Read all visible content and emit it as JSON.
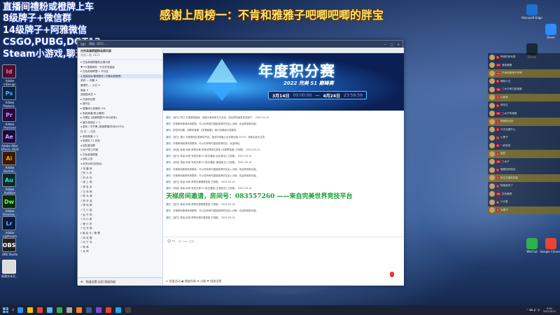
{
  "overlay": {
    "lines": [
      "直播间禮粉或橙牌上车",
      "8级牌子+微信群",
      "14级牌子+阿雅微信",
      "CSGO,PUBG,DOTA2",
      "Steam小游戏,聊天"
    ],
    "thanks": "感谢上周榜一：不肯和雅雅子吧唧吧唧的胖宝"
  },
  "desktop_left": [
    {
      "abbr": "Id",
      "label": "Adobe InDesign",
      "color": "#4a0f2e",
      "fg": "#ff6fa0"
    },
    {
      "abbr": "Ps",
      "label": "Adobe Photosh...",
      "color": "#0b2340",
      "fg": "#4ab3ff"
    },
    {
      "abbr": "Pr",
      "label": "Adobe Premiere",
      "color": "#250a3a",
      "fg": "#c58bff"
    },
    {
      "abbr": "Ae",
      "label": "Adobe After Effects 2020",
      "color": "#1a0a3a",
      "fg": "#c8a0ff"
    },
    {
      "abbr": "Ai",
      "label": "Adobe Illustrat...",
      "color": "#3a1a00",
      "fg": "#ff9a2a"
    },
    {
      "abbr": "Au",
      "label": "Adobe Audition",
      "color": "#0a2a2a",
      "fg": "#3de0c0"
    },
    {
      "abbr": "Dw",
      "label": "Adobe Dreamw...",
      "color": "#0a2a0a",
      "fg": "#6aff6a"
    },
    {
      "abbr": "Lr",
      "label": "Adobe Lightroom",
      "color": "#0a1a3a",
      "fg": "#6ab0ff"
    },
    {
      "abbr": "OBS",
      "label": "OBS Studio",
      "color": "#222",
      "fg": "#fff"
    },
    {
      "abbr": "",
      "label": "新建文本文...",
      "color": "#ddd",
      "fg": "#333"
    }
  ],
  "desktop_right": [
    {
      "label": "Microsoft Edge",
      "color": "#1f6fd1"
    },
    {
      "label": "Zoom",
      "color": "#2d8cff"
    },
    {
      "label": "Steam",
      "color": "#1b2838"
    },
    {
      "label": "WeChat",
      "color": "#2bb24c"
    },
    {
      "label": "Google Chrome",
      "color": "#e94335"
    }
  ],
  "window": {
    "title_left": "SBC",
    "title_center": "频道: 1853 …",
    "left_header": "白色英雄联盟粉丝俱乐部",
    "left_header_sub": "频道人数 1853",
    "tree": [
      "▾ 白色英雄联盟粉丝俱乐部",
      "  ♥ PG语音服务 · 不允许发链接",
      "  ▾ 白色英雄联盟 1 不分区",
      "    ◂ 语音接待/管理服务 (不要私聊管理)",
      "      老铁 — 阿雅 ✦",
      "      管理员 — 小白 ✦",
      "      兔兔 ✦",
      "      语音接待员 ✦",
      "    ▸ 白色粉丝群",
      "    ▸ 娱乐区",
      "    ▸ 直播间公会福利 LOL",
      "  ▸ 电竞频道(禁止喧哗)",
      "  ▸ 开黑区 [英雄联盟/PUBG/其他]",
      "  ▸ 娱乐游戏区 (一)",
      "    ◂ 游戏 / 不开黑 (英雄联盟/吃鸡/DOTA)",
      "      白 光 — 白光",
      "  ▸ 电竞频道 (一)",
      "    ◂ 电竞队 T1 白色",
      "    ◂ 战队集训群",
      "      小伙子的工作室",
      "  ▸ 白色英雄联盟",
      "    ◂ 战队公告",
      "    ◂ 合作伙伴(仅粉丝)",
      "      ♪ 张 晨 辉",
      "      ♪ 陆 人 友",
      "      ♪ 刘 天 光",
      "      ♪ 梁 上 明",
      "      ♪ 吴 友 名",
      "      ♪ 王 亮 明",
      "      ♪ 陈 大 海",
      "      ♪ 林 天 浩",
      "      ♪ 李 尚 明",
      "      ♪ 王 小 金",
      "      ♪ 赵 子 风",
      "      ♪ 冯 小 新",
      "      ♪ 程 小 东",
      "      ♪ 白 光 辉",
      "  ▸ 副 会 长 / 管 理",
      "      ♪ 风 花 雪",
      "      ♪ 月 下 光",
      "      ♪ 秋 林",
      "      ♪ 北 风"
    ],
    "left_footer": "频道设置   应用   频道功能",
    "banner": {
      "title": "年度积分赛",
      "subtitle": "2022 完美 S1 巅峰赛",
      "date1": "3月14日",
      "time1": "00:00:00",
      "date2": "4月24日",
      "time2": "23:59:59"
    },
    "chat": [
      {
        "tag": "通知:",
        "text": "[官方] 昨日 天梯赛事结束，感谢大家的参与与支持，奖品将陆续发放至账户。 2022-03-13"
      },
      {
        "tag": "通知:",
        "text": "天梯房间邀请系统更新，可以在房间内直接邀请好友加入对局，欢迎体验新功能。"
      },
      {
        "tag": "通知:",
        "text": "如您有问题，请联系客服  【完美客服】  我们将竭诚为您服务。"
      },
      {
        "tag": "通知:",
        "text": "[官方] 周六 天梯赛段位赛即将开启，报名时间截止至本周五晚 23:59，请各位选手注意。"
      },
      {
        "tag": "通知:",
        "text": "天梯房间邀请系统更新，可以在房间内直接邀请好友，欢迎体验。"
      },
      {
        "tag": "通知:",
        "text": "[系统] 恭喜 玩家 获得天梯 完美世界排位奖励 (月赛季奖励)  已到账。 2022-03-14"
      },
      {
        "tag": "通知:",
        "text": "[官方] 恭喜 玩家 完成天梯 S1 段位晋级 (钻石段位)  已到账。 2022-03-14"
      },
      {
        "tag": "通知:",
        "text": "[系统] 恭喜 玩家 完成天梯 S1 段位晋级 (黄金段位)  已到账。 2022-03-14"
      },
      {
        "tag": "通知:",
        "text": "天梯房间邀请系统更新，可以在房间内直接邀请好友加入对局，欢迎体验新功能。"
      },
      {
        "tag": "通知:",
        "text": "天梯房间邀请系统更新，可以在房间内直接邀请好友加入对局，欢迎体验新功能。"
      },
      {
        "tag": "通知:",
        "text": "[官方] 恭喜 玩家 获得天梯周赛奖励  已到账。 2022-03-14"
      },
      {
        "tag": "通知:",
        "text": "[系统] 恭喜 玩家 完成天梯 S1 段位晋级 (王者段位)  已到账。 2022-03-14"
      }
    ],
    "highlight": "天梯房间邀请，房间号：083557260 ——来自完美世界竞技平台",
    "chat2": [
      {
        "tag": "通知:",
        "text": "[官方] 恭喜 玩家 获得天梯周赛奖励  已到账。 2022-03-14"
      },
      {
        "tag": "通知:",
        "text": "天梯房间邀请系统更新，可以在房间内直接邀请好友加入对局，欢迎体验新功能。"
      },
      {
        "tag": "通知:",
        "text": "[官方] 恭喜 玩家 获得天梯月赛奖励  已到账。 2022-03-14"
      }
    ],
    "input_placeholder": "按 Enter 发送...",
    "input_tools": "☺  ✂",
    "input_bottom": "⊙  频道活动    ▣  播放伴奏    ⚙  点歌    ⚑  频道设置"
  },
  "right_chat": [
    {
      "name": "阿雅的夜来香",
      "badge": "8",
      "hl": false
    },
    {
      "name": "菠菜猪猪",
      "badge": "12",
      "hl": false
    },
    {
      "name": "不肯和雅雅子吧唧",
      "badge": "14",
      "hl": true
    },
    {
      "name": "萌新小白",
      "badge": "6",
      "hl": false
    },
    {
      "name": "三木子和白色雅雅",
      "badge": "10",
      "hl": false
    },
    {
      "name": "小胖宝",
      "badge": "9",
      "hl": true
    },
    {
      "name": "风吹过",
      "badge": "5",
      "hl": false
    },
    {
      "name": "三木子的雅雅",
      "badge": "11",
      "hl": false
    },
    {
      "name": "阿雅粉丝团",
      "badge": "7",
      "hl": true
    },
    {
      "name": "今天也要开心",
      "badge": "4",
      "hl": false
    },
    {
      "name": "小黑子",
      "badge": "3",
      "hl": false
    },
    {
      "name": "一杯奶茶",
      "badge": "8",
      "hl": false
    },
    {
      "name": "星辰",
      "badge": "6",
      "hl": true
    },
    {
      "name": "三木子",
      "badge": "12",
      "hl": false
    },
    {
      "name": "雅雅的好朋友",
      "badge": "5",
      "hl": false
    },
    {
      "name": "夜空中最亮的星",
      "badge": "9",
      "hl": true
    },
    {
      "name": "阿雅我来了",
      "badge": "4",
      "hl": false
    },
    {
      "name": "白色雅雅",
      "badge": "10",
      "hl": false
    },
    {
      "name": "小可爱",
      "badge": "6",
      "hl": false
    },
    {
      "name": "大橘子",
      "badge": "8",
      "hl": true
    }
  ],
  "taskbar": {
    "apps": [
      "#1e90ff",
      "#f2c200",
      "#e04a2a",
      "#5ab0ff",
      "#2bb24c",
      "#aaa",
      "#ff7f27",
      "#3b5998",
      "#7a4bd1",
      "#e94335",
      "#22a7f0",
      "#444"
    ],
    "time": "9:40",
    "date": "2022/4/22",
    "tray": "^ ⌨ 🔊 中"
  }
}
